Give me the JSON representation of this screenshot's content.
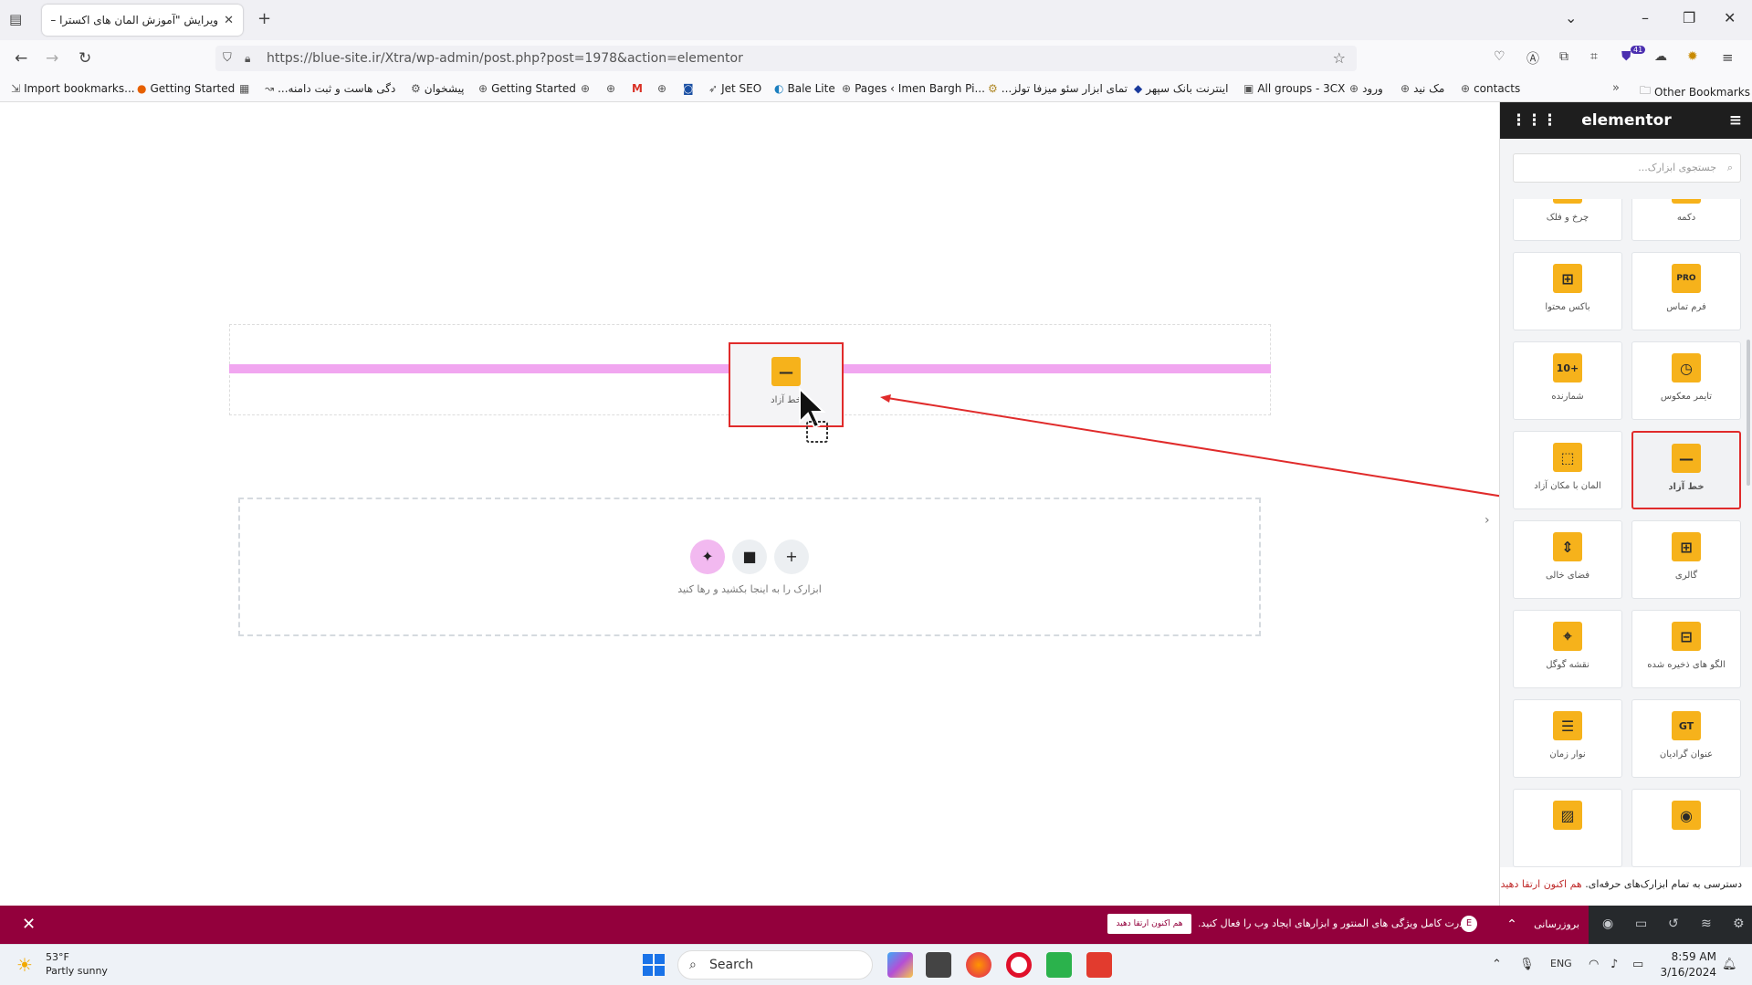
{
  "browser": {
    "tab_title": "ویرایش \"آموزش المان های اکسترا –",
    "url": "https://blue-site.ir/Xtra/wp-admin/post.php?post=1978&action=elementor",
    "extension_badge": "41",
    "bookmarks": [
      "Import bookmarks...",
      "Getting Started",
      "...دگی هاست و ثبت دامنه",
      "پیشخوان",
      "Getting Started",
      "Jet SEO",
      "Bale Lite",
      "Pages ‹ Imen Bargh Pi...",
      "...تمای ابزار سئو میزفا تولز",
      "اینترنت بانک سپهر",
      "All groups - 3CX",
      "ورود",
      "مک نید",
      "contacts"
    ],
    "other_bookmarks": "Other Bookmarks"
  },
  "canvas": {
    "dragged_widget_label": "خط آزاد",
    "dropzone_text": "ابزارک را به اینجا بکشید و رها کنید"
  },
  "panel": {
    "brand": "elementor",
    "search_placeholder": "جستجوی ابزارک...",
    "widgets": [
      {
        "label": "چرخ و فلک",
        "icon": "code-icon"
      },
      {
        "label": "دکمه",
        "icon": "button-icon"
      },
      {
        "label": "باکس محتوا",
        "icon": "content-box-icon"
      },
      {
        "label": "فرم تماس",
        "icon": "form-pro-icon",
        "text": "PRO"
      },
      {
        "label": "شمارنده",
        "icon": "counter-icon",
        "text": "10+"
      },
      {
        "label": "تایمر معکوس",
        "icon": "timer-icon"
      },
      {
        "label": "المان با مکان آزاد",
        "icon": "free-position-icon"
      },
      {
        "label": "خط آزاد",
        "icon": "divider-icon",
        "selected": true
      },
      {
        "label": "فضای خالی",
        "icon": "spacer-icon"
      },
      {
        "label": "گالری",
        "icon": "gallery-icon"
      },
      {
        "label": "نقشه گوگل",
        "icon": "map-pin-icon"
      },
      {
        "label": "الگو های ذخیره شده",
        "icon": "template-icon"
      },
      {
        "label": "نوار زمان",
        "icon": "timeline-icon"
      },
      {
        "label": "عنوان گرادیان",
        "icon": "gradient-title-icon",
        "text": "GT"
      },
      {
        "label": "",
        "icon": "image-icon"
      },
      {
        "label": "",
        "icon": "hotspot-icon"
      }
    ],
    "promo_text": "دسترسی به تمام ابزارک‌های حرفه‌ای.",
    "promo_link": "هم اکنون ارتقا دهید"
  },
  "bottom_bar": {
    "message": "قدرت کامل ویژگی های المنتور و ابزارهای ایجاد وب را فعال کنید.",
    "upgrade_button": "هم اکنون ارتقا دهید",
    "publish_label": "بروزرسانی"
  },
  "taskbar": {
    "weather_temp": "53°F",
    "weather_desc": "Partly sunny",
    "search_placeholder": "Search",
    "language": "ENG",
    "time": "8:59 AM",
    "date": "3/16/2024"
  },
  "colors": {
    "accent": "#f6b21b",
    "highlight": "#e02b2b",
    "pink_line": "#f1a6f0",
    "bar": "#93003c"
  }
}
